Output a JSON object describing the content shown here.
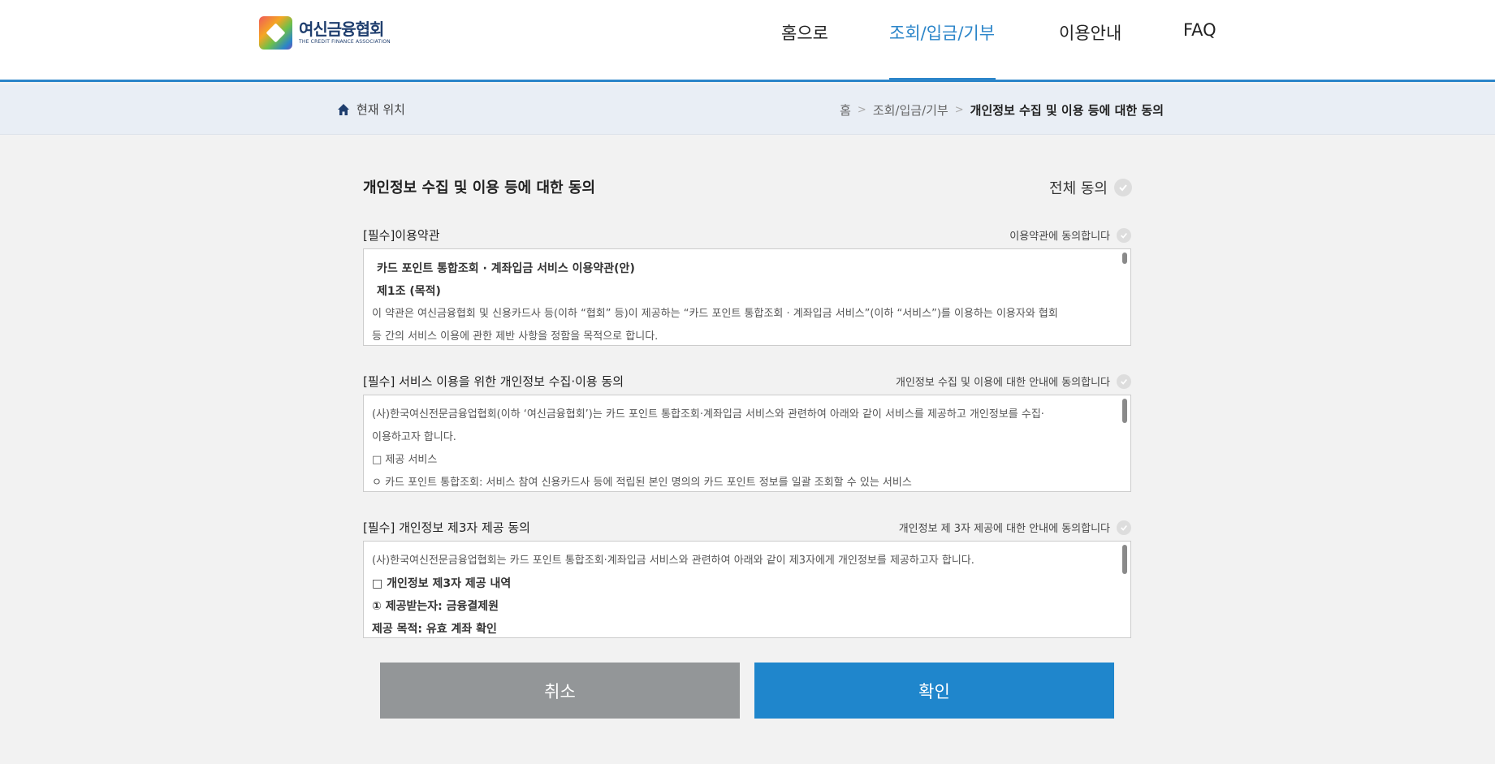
{
  "header": {
    "logo_ko": "여신금융협회",
    "logo_en": "THE CREDIT FINANCE ASSOCIATION",
    "nav": [
      "홈으로",
      "조회/입금/기부",
      "이용안내",
      "FAQ"
    ],
    "active_nav": "조회/입금/기부"
  },
  "location": {
    "label": "현재 위치",
    "crumbs": [
      "홈",
      "조회/입금/기부",
      "개인정보 수집 및 이용 등에 대한 동의"
    ]
  },
  "main": {
    "title": "개인정보 수집 및 이용 등에 대한 동의",
    "agree_all": "전체 동의",
    "terms": [
      {
        "label": "[필수]이용약관",
        "agree_text": "이용약관에 동의합니다",
        "lines": [
          "카드 포인트 통합조회 · 계좌입금 서비스 이용약관(안)",
          "제1조 (목적)",
          "이 약관은 여신금융협회 및 신용카드사 등(이하 “협회” 등)이 제공하는 “카드 포인트 통합조회 · 계좌입금 서비스”(이하 “서비스”)를 이용하는 이용자와 협회",
          "등 간의 서비스 이용에 관한 제반 사항을 정함을 목적으로 합니다."
        ]
      },
      {
        "label": "[필수] 서비스 이용을 위한 개인정보 수집·이용 동의",
        "agree_text": "개인정보 수집 및 이용에 대한 안내에 동의합니다",
        "lines": [
          "(사)한국여신전문금융업협회(이하 ‘여신금융협회’)는 카드 포인트 통합조회·계좌입금 서비스와 관련하여 아래와 같이 서비스를 제공하고 개인정보를 수집·",
          "이용하고자 합니다.",
          "□ 제공 서비스",
          "ㅇ 카드 포인트 통합조회: 서비스 참여 신용카드사 등에 적립된 본인 명의의 카드 포인트 정보를 일괄 조회할 수 있는 서비스"
        ]
      },
      {
        "label": "[필수] 개인정보 제3자 제공 동의",
        "agree_text": "개인정보 제 3자 제공에 대한 안내에 동의합니다",
        "lines": [
          "(사)한국여신전문금융업협회는 카드 포인트 통합조회·계좌입금 서비스와 관련하여 아래와 같이 제3자에게 개인정보를 제공하고자 합니다.",
          "□ 개인정보 제3자 제공 내역",
          "① 제공받는자: 금융결제원",
          "제공 목적: 유효 계좌 확인"
        ]
      }
    ]
  },
  "buttons": {
    "cancel": "취소",
    "ok": "확인"
  },
  "colors": {
    "accent": "#2b85c9",
    "cancel_bg": "#939698",
    "ok_bg": "#1f86cc"
  }
}
